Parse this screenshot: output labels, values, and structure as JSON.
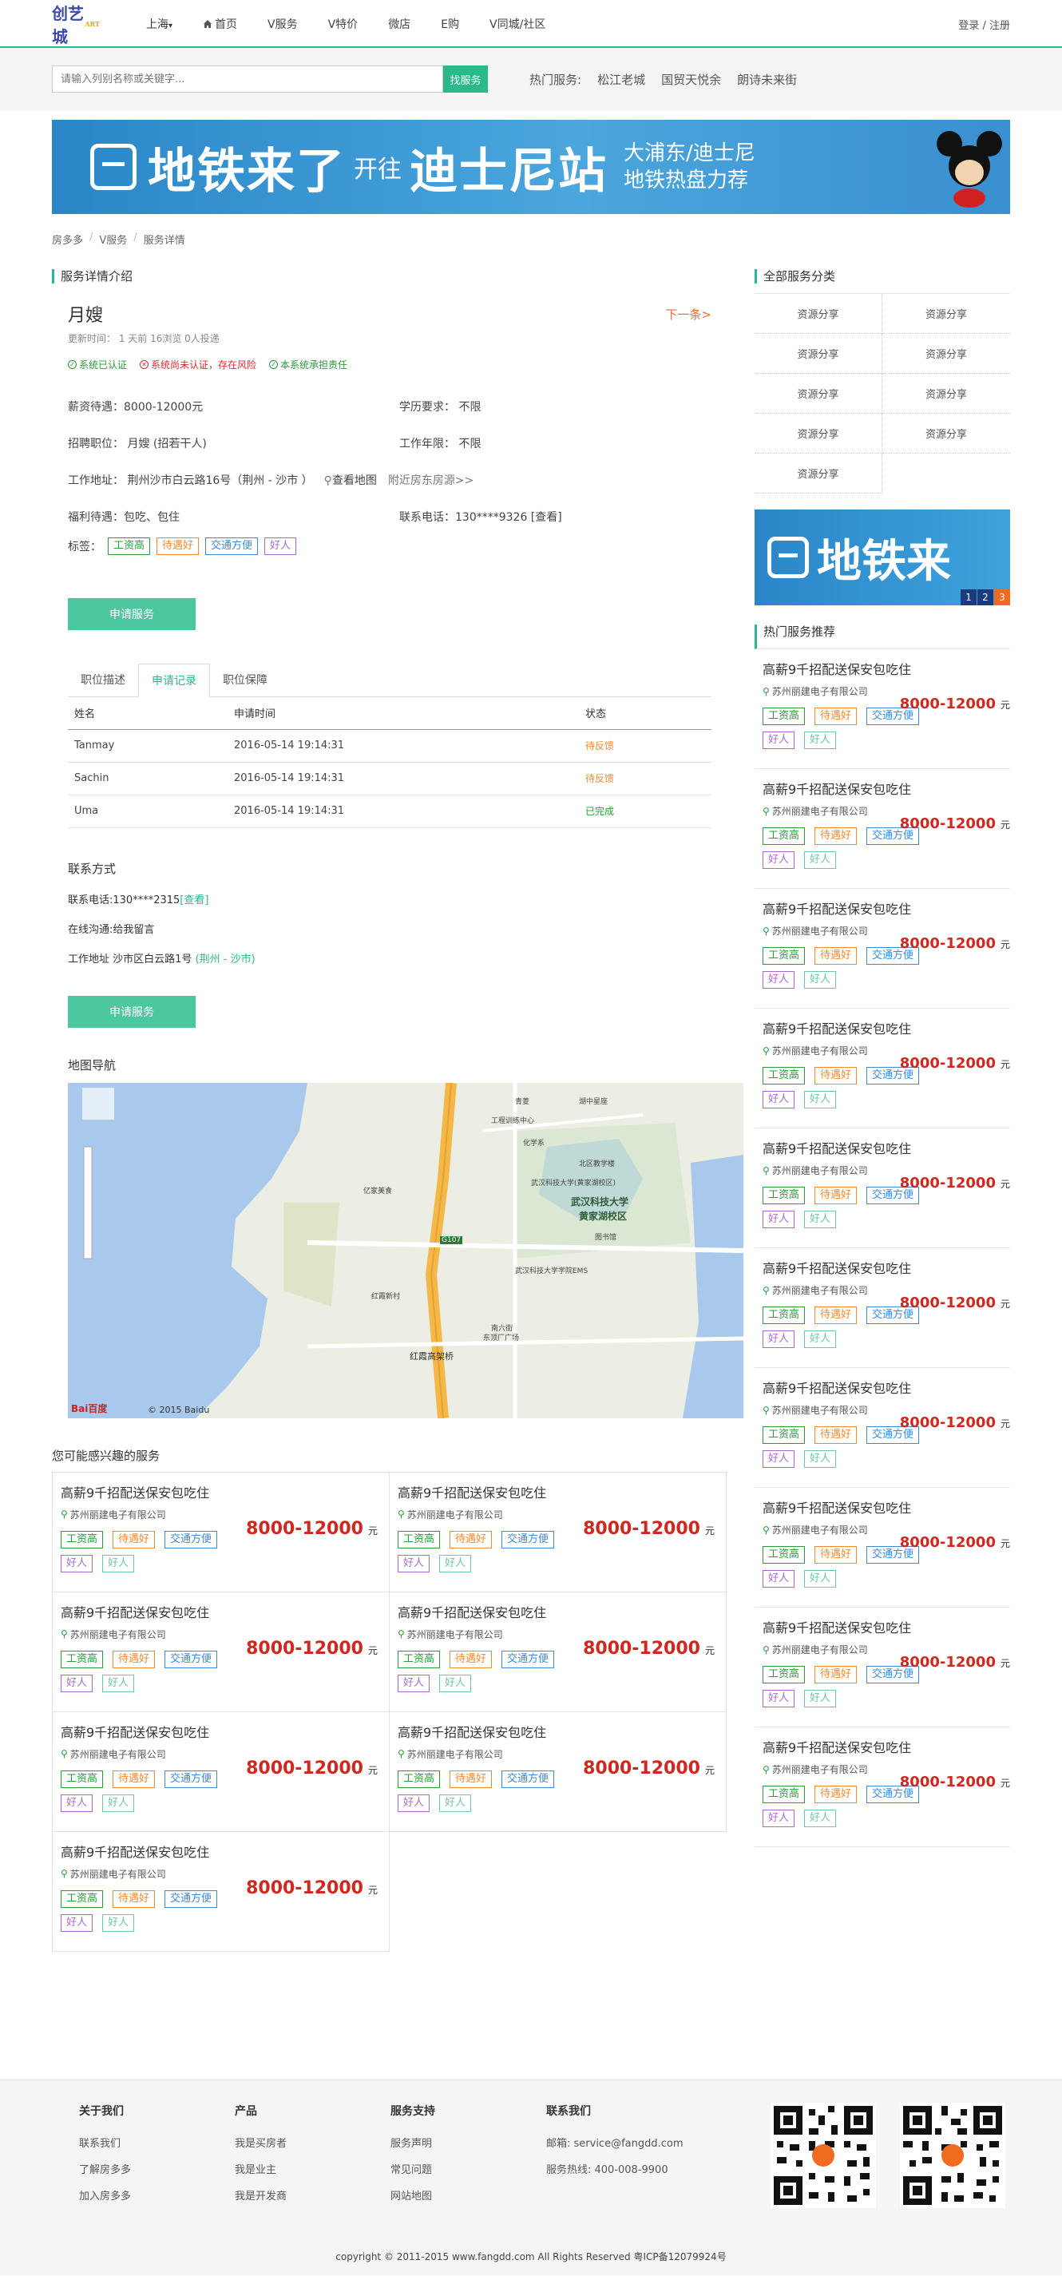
{
  "nav": {
    "logo_text": "创艺城",
    "logo_sub": "ART",
    "city": "上海",
    "items": [
      {
        "label": "首页",
        "icon": "home-icon"
      },
      {
        "label": "V服务"
      },
      {
        "label": "V特价"
      },
      {
        "label": "微店"
      },
      {
        "label": "E购"
      },
      {
        "label": "V同城/社区"
      }
    ],
    "login": "登录 / 注册"
  },
  "search": {
    "placeholder": "请输入列别名称或关键字...",
    "button": "找服务",
    "hot_label": "热门服务:",
    "hot_items": [
      "松江老城",
      "国贸天悦余",
      "朗诗未来街"
    ]
  },
  "banner": {
    "main_text": "地铁来了",
    "middle_text": "开往",
    "dest_text": "迪士尼站",
    "right_line1": "大浦东/迪士尼",
    "right_line2": "地铁热盘力荐"
  },
  "breadcrumb": [
    "房多多",
    "V服务",
    "服务详情"
  ],
  "detail": {
    "section_title": "服务详情介绍",
    "title": "月嫂",
    "next": "下一条>",
    "meta": "更新时间： 1 天前  16浏览  0人投递",
    "certs": [
      {
        "text": "系统已认证",
        "kind": "ok"
      },
      {
        "text": "系统尚未认证，存在风险",
        "kind": "bad"
      },
      {
        "text": "本系统承担责任",
        "kind": "ok"
      }
    ],
    "salary": "薪资待遇：8000-12000元",
    "education": "学历要求： 不限",
    "position": "招聘职位： 月嫂 (招若干人)",
    "years": "工作年限： 不限",
    "address": "工作地址： 荆州沙市白云路16号（荆州 - 沙市 ）",
    "map_link": "查看地图",
    "nearby": "附近房东房源>>",
    "welfare": "福利待遇：包吃、包住",
    "phone": "联系电话：130****9326 [查看]",
    "tags_label": "标签：",
    "tags": [
      "工资高",
      "待遇好",
      "交通方便",
      "好人"
    ],
    "apply": "申请服务"
  },
  "tabs": [
    "职位描述",
    "申请记录",
    "职位保障"
  ],
  "records": {
    "headers": [
      "姓名",
      "申请时间",
      "状态"
    ],
    "rows": [
      {
        "name": "Tanmay",
        "time": "2016-05-14 19:14:31",
        "status": "待反馈",
        "kind": "wait"
      },
      {
        "name": "Sachin",
        "time": "2016-05-14 19:14:31",
        "status": "待反馈",
        "kind": "wait"
      },
      {
        "name": "Uma",
        "time": "2016-05-14 19:14:31",
        "status": "已完成",
        "kind": "done"
      }
    ]
  },
  "contact": {
    "title": "联系方式",
    "phone_prefix": "联系电话:130****2315",
    "phone_link": "[查看]",
    "online": "在线沟通:给我留言",
    "address_prefix": "工作地址 沙市区白云路1号",
    "address_link": "(荆州 - 沙市)",
    "apply": "申请服务"
  },
  "map": {
    "title": "地图导航",
    "labels": [
      {
        "text": "武汉科技大学",
        "kind": "big"
      },
      {
        "text": "黄家湖校区",
        "kind": "big"
      },
      {
        "text": "武汉科技大学(黄家湖校区)",
        "kind": "small"
      },
      {
        "text": "武汉科技大学学院EMS",
        "kind": "small"
      },
      {
        "text": "红霞高架桥",
        "kind": "mid"
      },
      {
        "text": "青菱",
        "kind": "small"
      },
      {
        "text": "湖中星座",
        "kind": "small"
      },
      {
        "text": "工程训练中心",
        "kind": "small"
      },
      {
        "text": "化学系",
        "kind": "small"
      },
      {
        "text": "北区教学楼",
        "kind": "small"
      },
      {
        "text": "图书馆",
        "kind": "small"
      },
      {
        "text": "东顶厂广场",
        "kind": "small"
      },
      {
        "text": "南六街",
        "kind": "small"
      },
      {
        "text": "红霞新村",
        "kind": "small"
      },
      {
        "text": "亿家美食",
        "kind": "small"
      },
      {
        "text": "G107",
        "kind": "road"
      }
    ],
    "copyright": "© 2015 Baidu",
    "logo": "Bai百度"
  },
  "interest": {
    "title": "您可能感兴趣的服务",
    "cards": [
      {
        "title": "高薪9千招配送保安包吃住",
        "company": "苏州丽建电子有限公司",
        "price": "8000-12000",
        "unit": "元"
      },
      {
        "title": "高薪9千招配送保安包吃住",
        "company": "苏州丽建电子有限公司",
        "price": "8000-12000",
        "unit": "元"
      },
      {
        "title": "高薪9千招配送保安包吃住",
        "company": "苏州丽建电子有限公司",
        "price": "8000-12000",
        "unit": "元"
      },
      {
        "title": "高薪9千招配送保安包吃住",
        "company": "苏州丽建电子有限公司",
        "price": "8000-12000",
        "unit": "元"
      },
      {
        "title": "高薪9千招配送保安包吃住",
        "company": "苏州丽建电子有限公司",
        "price": "8000-12000",
        "unit": "元"
      },
      {
        "title": "高薪9千招配送保安包吃住",
        "company": "苏州丽建电子有限公司",
        "price": "8000-12000",
        "unit": "元"
      },
      {
        "title": "高薪9千招配送保安包吃住",
        "company": "苏州丽建电子有限公司",
        "price": "8000-12000",
        "unit": "元"
      }
    ],
    "tags": [
      "工资高",
      "待遇好",
      "交通方便",
      "好人",
      "好人"
    ]
  },
  "sidebar": {
    "categories_title": "全部服务分类",
    "categories": [
      "资源分享",
      "资源分享",
      "资源分享",
      "资源分享",
      "资源分享",
      "资源分享",
      "资源分享",
      "资源分享",
      "资源分享"
    ],
    "banner_text": "地铁来",
    "pager": [
      "1",
      "2",
      "3"
    ],
    "hot_title": "热门服务推荐",
    "hot_cards": [
      {
        "title": "高薪9千招配送保安包吃住",
        "company": "苏州丽建电子有限公司",
        "price": "8000-12000",
        "unit": "元"
      },
      {
        "title": "高薪9千招配送保安包吃住",
        "company": "苏州丽建电子有限公司",
        "price": "8000-12000",
        "unit": "元"
      },
      {
        "title": "高薪9千招配送保安包吃住",
        "company": "苏州丽建电子有限公司",
        "price": "8000-12000",
        "unit": "元"
      },
      {
        "title": "高薪9千招配送保安包吃住",
        "company": "苏州丽建电子有限公司",
        "price": "8000-12000",
        "unit": "元"
      },
      {
        "title": "高薪9千招配送保安包吃住",
        "company": "苏州丽建电子有限公司",
        "price": "8000-12000",
        "unit": "元"
      },
      {
        "title": "高薪9千招配送保安包吃住",
        "company": "苏州丽建电子有限公司",
        "price": "8000-12000",
        "unit": "元"
      },
      {
        "title": "高薪9千招配送保安包吃住",
        "company": "苏州丽建电子有限公司",
        "price": "8000-12000",
        "unit": "元"
      },
      {
        "title": "高薪9千招配送保安包吃住",
        "company": "苏州丽建电子有限公司",
        "price": "8000-12000",
        "unit": "元"
      },
      {
        "title": "高薪9千招配送保安包吃住",
        "company": "苏州丽建电子有限公司",
        "price": "8000-12000",
        "unit": "元"
      },
      {
        "title": "高薪9千招配送保安包吃住",
        "company": "苏州丽建电子有限公司",
        "price": "8000-12000",
        "unit": "元"
      }
    ]
  },
  "footer": {
    "columns": [
      {
        "title": "关于我们",
        "links": [
          "联系我们",
          "了解房多多",
          "加入房多多"
        ]
      },
      {
        "title": "产品",
        "links": [
          "我是买房者",
          "我是业主",
          "我是开发商"
        ]
      },
      {
        "title": "服务支持",
        "links": [
          "服务声明",
          "常见问题",
          "网站地图"
        ]
      },
      {
        "title": "联系我们",
        "links": [
          "邮箱: service@fangdd.com",
          "服务热线: 400-008-9900"
        ]
      }
    ],
    "copyright": "copyright © 2011-2015 www.fangdd.com All Rights Reserved 粤ICP备12079924号"
  },
  "colors": {
    "accent": "#2bb88a",
    "price": "#d0281e",
    "link_orange": "#f06a30",
    "banner": "#2b86c8"
  }
}
